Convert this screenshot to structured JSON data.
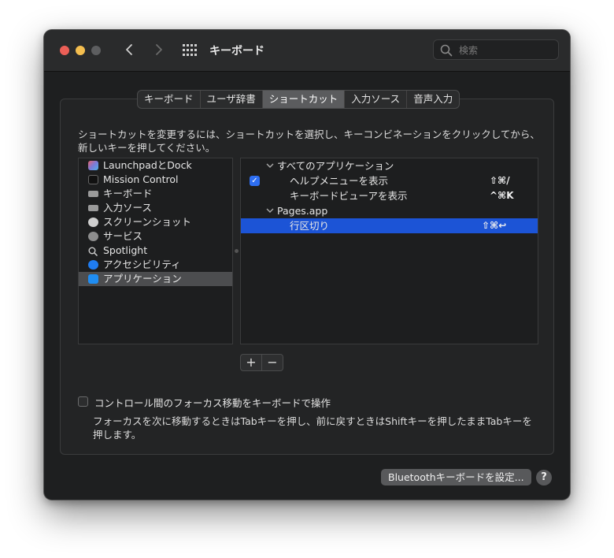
{
  "window": {
    "title": "キーボード"
  },
  "search": {
    "placeholder": "検索"
  },
  "tabs": [
    {
      "label": "キーボード"
    },
    {
      "label": "ユーザ辞書"
    },
    {
      "label": "ショートカット",
      "active": true
    },
    {
      "label": "入力ソース"
    },
    {
      "label": "音声入力"
    }
  ],
  "description": "ショートカットを変更するには、ショートカットを選択し、キーコンビネーションをクリックしてから、新しいキーを押してください。",
  "categories": [
    {
      "label": "LaunchpadとDock",
      "icon": "launchpad-icon"
    },
    {
      "label": "Mission Control",
      "icon": "mission-control-icon"
    },
    {
      "label": "キーボード",
      "icon": "keyboard-icon"
    },
    {
      "label": "入力ソース",
      "icon": "keyboard-icon"
    },
    {
      "label": "スクリーンショット",
      "icon": "screenshot-icon"
    },
    {
      "label": "サービス",
      "icon": "gear-icon"
    },
    {
      "label": "Spotlight",
      "icon": "search-icon"
    },
    {
      "label": "アクセシビリティ",
      "icon": "accessibility-icon"
    },
    {
      "label": "アプリケーション",
      "icon": "app-store-icon",
      "selected": true
    }
  ],
  "shortcuts": [
    {
      "type": "group",
      "label": "すべてのアプリケーション"
    },
    {
      "type": "item",
      "label": "ヘルプメニューを表示",
      "key": "⇧⌘/",
      "checked": true
    },
    {
      "type": "item",
      "label": "キーボードビューアを表示",
      "key": "^⌘K"
    },
    {
      "type": "group",
      "label": "Pages.app"
    },
    {
      "type": "item",
      "label": "行区切り",
      "key": "⇧⌘↩",
      "selected": true
    }
  ],
  "buttons": {
    "add": "+",
    "remove": "−",
    "bluetooth": "Bluetoothキーボードを設定...",
    "help": "?"
  },
  "focus": {
    "label": "コントロール間のフォーカス移動をキーボードで操作",
    "checked": false,
    "description": "フォーカスを次に移動するときはTabキーを押し、前に戻すときはShiftキーを押したままTabキーを押します。"
  },
  "colors": {
    "selection": "#1c54d6",
    "accent": "#2d6ef2",
    "close": "#ec5f57",
    "minimize": "#f4be4f"
  }
}
